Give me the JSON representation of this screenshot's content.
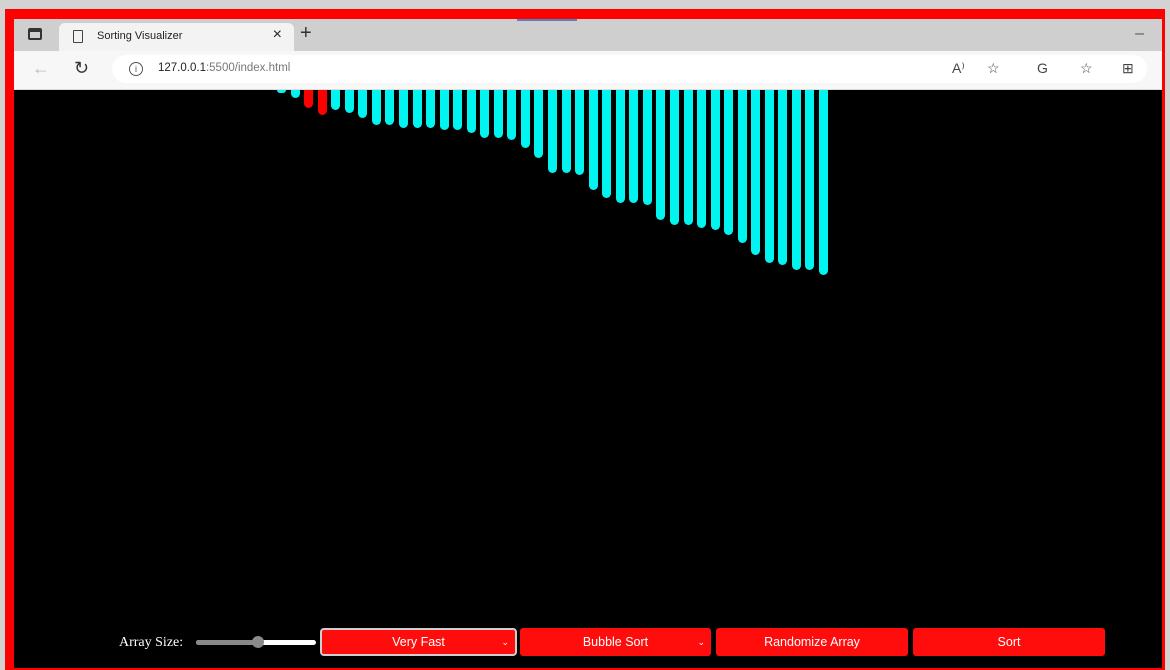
{
  "browser": {
    "tab_title": "Sorting Visualizer",
    "tab_close": "×",
    "new_tab": "+",
    "minimize": "–",
    "url_host": "127.0.0.1",
    "url_path": ":5500/index.html",
    "info_glyph": "i",
    "back_glyph": "←",
    "reload_glyph": "↻",
    "toolbar_icons": [
      {
        "name": "read-aloud-icon",
        "glyph": "A⁾"
      },
      {
        "name": "favorite-add-icon",
        "glyph": "☆"
      },
      {
        "name": "extension-icon",
        "glyph": "G"
      },
      {
        "name": "favorites-icon",
        "glyph": "☆"
      },
      {
        "name": "collections-icon",
        "glyph": "⊞"
      }
    ]
  },
  "visualizer": {
    "bar_color": "#00f5f0",
    "active_color": "#ff0000",
    "active_indices": [
      2,
      3
    ],
    "bar_values": [
      1,
      3,
      7,
      10,
      8,
      9,
      11,
      14,
      14,
      15,
      15,
      15,
      16,
      16,
      17,
      19,
      19,
      20,
      23,
      27,
      33,
      33,
      34,
      40,
      43,
      45,
      45,
      46,
      52,
      54,
      54,
      55,
      56,
      58,
      61,
      66,
      69,
      70,
      72,
      72,
      74
    ]
  },
  "controls": {
    "array_size_label": "Array Size:",
    "array_size_fraction": 0.52,
    "speed_selected": "Very Fast",
    "algorithm_selected": "Bubble Sort",
    "randomize_label": "Randomize Array",
    "sort_label": "Sort",
    "caret": "⌄"
  }
}
